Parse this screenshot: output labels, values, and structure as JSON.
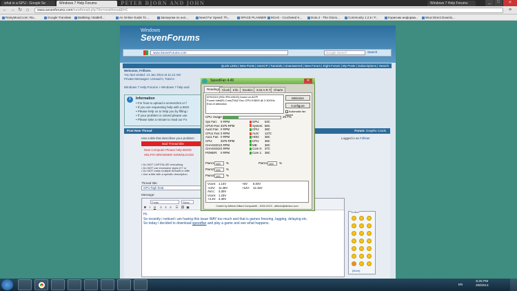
{
  "browser": {
    "tabs": [
      {
        "label": "what is a GPU - Google Se"
      },
      {
        "label": "Windows 7 Help Forums"
      },
      {
        "label": "Windows 7 Help Forums"
      }
    ],
    "deco_text": "PETER BJORN AND JOHN",
    "url_domain": "www.sevenforums.com",
    "url_path": "/newthread.php?do=newthread&f=6",
    "bookmarks": [
      "RainyMood.com: Ra...",
      "Google Translate",
      "Battlelog / Battlefi...",
      "An Online Guide To ...",
      "Запокупки по онл...",
      "Need For Speed: Th...",
      "SPACE PLANNER",
      "9GAG - Crocheted K...",
      "Dota 2 - The Glorio...",
      "Community 1.2.5 / F...",
      "Корисник информа...",
      "Wuxi Direct Downlo..."
    ]
  },
  "site": {
    "logo_small": "Windows",
    "logo_big": "SevenForums",
    "search_value": "www.SevenForums.com",
    "search_placeholder": "Google Search",
    "search_button": "Search",
    "nav": "Quick Links | New Posts | UserCP | Tutorials | Unanswered | New Forum | Eight Forum | My Posts | Subscriptions | Search",
    "welcome": "Welcome, Frillster.",
    "last_visit": "You last visited: 13 Jan 2014 at 11:12 AM",
    "private": "Private Messages: Unread 0, Total 0.",
    "crumb": "Windows 7 Help Forums » Windows 7 help and",
    "info_title": "Information",
    "info_items": [
      "For how to upload a screenshot or f",
      "If you are requesting help with a BSO",
      "Please help us to help you by filling i",
      "If your problem is solved please use",
      "Please take a minute to read our Fo"
    ],
    "post_title": "Post New Thread",
    "forum_label": "Forum:",
    "forum_value": "Graphic Cards",
    "logged": "Logged in as",
    "logged_user": "Frillster",
    "use_title": "Use a title that describes your problem",
    "bad_title": "Bad Thread title",
    "red1": "New Computer Please help BSOD",
    "red2": "HELP!!!! BROWSER DOWNLOADS",
    "tip1": "• Do NOT CAPITALIZE everything",
    "tip2": "• Do NOT use excessive signs (!!? or",
    "tip3": "• Do NOT make multiple threads in diffe",
    "tip4": "• Use a title with a specific description",
    "title_label": "Thread title:",
    "title_value": "GPU high heat",
    "msg_label": "Message:",
    "font_dd": "Fonts",
    "size_dd": "Sizes",
    "body_line1": "Hi.",
    "body_line2a": "So recently i noticed i am having this issue WAY too much and that is games freezing, lagging, delaying etc.",
    "body_line3a": "So today i decided to download ",
    "body_link": "speedfan",
    "body_line3b": " and play a game and see what happens.",
    "smilies_label": "Smilies",
    "more": "[More]"
  },
  "speedfan": {
    "title": "SpeedFan 4.49",
    "tabs": [
      "Readings",
      "Clock",
      "Info",
      "Exotics",
      "S.M.A.R.T.",
      "Charts"
    ],
    "log": [
      "ATK0110 (HID=PM-ASUS) found on ACPI",
      "Found Intel(R) Core(TM)2 Duo CPU E4600 @ 2.40GHz",
      "End of detection"
    ],
    "minimize": "Minimize",
    "configure": "Configure",
    "auto_fan": "Automatic fan speed",
    "cpu_usage_label": "CPU Usage",
    "cpu_usage": "26.7%",
    "cpu_usage_value": 0.267,
    "fans": [
      {
        "name": "Sys Fan:",
        "value": "0 RPM"
      },
      {
        "name": "CPU0 Fan:",
        "value": "3375 RPM"
      },
      {
        "name": "Aux0 Fan:",
        "value": "0 RPM"
      },
      {
        "name": "CPU1 Fan:",
        "value": "0 RPM"
      },
      {
        "name": "Aux1 Fan:",
        "value": "0 RPM"
      },
      {
        "name": "CPU:",
        "value": "3375 RPM"
      },
      {
        "name": "CHASSIS1:",
        "value": "0 RPM"
      },
      {
        "name": "CHASSIS2:",
        "value": "0 RPM"
      },
      {
        "name": "POWER:",
        "value": "0 RPM"
      }
    ],
    "temps": [
      {
        "name": "GPU:",
        "value": "53C"
      },
      {
        "name": "System:",
        "value": "58C"
      },
      {
        "name": "CPU:",
        "value": "38C"
      },
      {
        "name": "AUX:",
        "value": "127C"
      },
      {
        "name": "HDD:",
        "value": "38C"
      },
      {
        "name": "CPU:",
        "value": "38C"
      },
      {
        "name": "MB:",
        "value": "38C"
      },
      {
        "name": "Core 0:",
        "value": "37C"
      },
      {
        "name": "Core 1:",
        "value": "38C"
      }
    ],
    "pwm": [
      {
        "name": "Pwm1:",
        "value": "100"
      },
      {
        "name": "Pwm2:",
        "value": "100"
      },
      {
        "name": "Pwm3:",
        "value": "100"
      },
      {
        "name": "Pwm1:",
        "value": "100"
      }
    ],
    "pct_sign": "%",
    "volts_left": [
      {
        "name": "Vcore:",
        "value": "1.14V"
      },
      {
        "name": "+12V:",
        "value": "11.46V"
      },
      {
        "name": "AVcc:",
        "value": "3.30V"
      },
      {
        "name": "Vcore:",
        "value": "1.15V"
      },
      {
        "name": "+3.3V:",
        "value": "3.30V"
      }
    ],
    "volts_right": [
      {
        "name": "+5V:",
        "value": "5.04V"
      },
      {
        "name": "+12V:",
        "value": "12.15V"
      }
    ],
    "coded": "Coded by Alfredo Milani Comparetti - 2000-2013 - alfredo@almico.com"
  },
  "taskbar": {
    "lang": "EN",
    "time": "6:25 PM",
    "date": "3/8/2014"
  }
}
